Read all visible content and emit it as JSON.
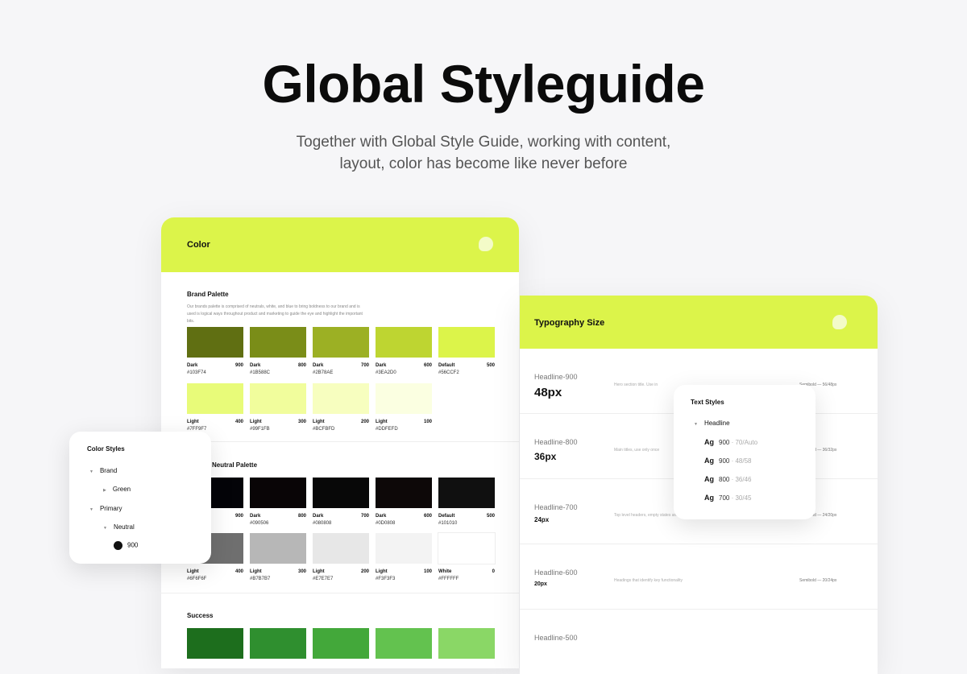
{
  "hero": {
    "title": "Global Styleguide",
    "subtitle_line1": "Together with Global Style Guide, working with content,",
    "subtitle_line2": "layout, color has become like never before"
  },
  "color_card": {
    "title": "Color",
    "brand": {
      "title": "Brand Palette",
      "description": "Our brands palette is comprised of neutrals, white, and blue to bring boldness to our brand and is used is logical ways throughout product and marketing to guide the eye and highlight the important bits.",
      "swatches": [
        {
          "name": "Dark",
          "num": "900",
          "hex": "#103F74",
          "color": "#606f12"
        },
        {
          "name": "Dark",
          "num": "800",
          "hex": "#1B588C",
          "color": "#7a8d18"
        },
        {
          "name": "Dark",
          "num": "700",
          "hex": "#2B78AE",
          "color": "#9cb024"
        },
        {
          "name": "Dark",
          "num": "600",
          "hex": "#3EA2D0",
          "color": "#bed531"
        },
        {
          "name": "Default",
          "num": "500",
          "hex": "#56CCF2",
          "color": "#dcf44a"
        },
        {
          "name": "Light",
          "num": "400",
          "hex": "#7FF9F7",
          "color": "#e8fb79"
        },
        {
          "name": "Light",
          "num": "300",
          "hex": "#99F1FB",
          "color": "#f1fd9c"
        },
        {
          "name": "Light",
          "num": "200",
          "hex": "#BCFBFD",
          "color": "#f7febf"
        },
        {
          "name": "Light",
          "num": "100",
          "hex": "#DDFEFD",
          "color": "#fbffe1"
        }
      ]
    },
    "neutral": {
      "title": "Neutral Palette",
      "swatches": [
        {
          "name": "Dark",
          "num": "900",
          "hex": "",
          "color": "#040408"
        },
        {
          "name": "Dark",
          "num": "800",
          "hex": "#090506",
          "color": "#090506"
        },
        {
          "name": "Dark",
          "num": "700",
          "hex": "#080808",
          "color": "#080808"
        },
        {
          "name": "Dark",
          "num": "600",
          "hex": "#0D0808",
          "color": "#0d0808"
        },
        {
          "name": "Default",
          "num": "500",
          "hex": "#101010",
          "color": "#101010"
        },
        {
          "name": "Light",
          "num": "400",
          "hex": "#6F6F6F",
          "color": "#6f6f6f"
        },
        {
          "name": "Light",
          "num": "300",
          "hex": "#B7B7B7",
          "color": "#b7b7b7"
        },
        {
          "name": "Light",
          "num": "200",
          "hex": "#E7E7E7",
          "color": "#e7e7e7"
        },
        {
          "name": "Light",
          "num": "100",
          "hex": "#F3F3F3",
          "color": "#f3f3f3"
        },
        {
          "name": "White",
          "num": "0",
          "hex": "#FFFFFF",
          "color": "#ffffff"
        }
      ]
    },
    "success": {
      "title": "Success",
      "swatches": [
        {
          "color": "#1d6e1d"
        },
        {
          "color": "#2f8f2f"
        },
        {
          "color": "#43a83a"
        },
        {
          "color": "#63c24f"
        },
        {
          "color": "#8ad766"
        }
      ]
    }
  },
  "type_card": {
    "title": "Typography Size",
    "rows": [
      {
        "name": "Headline-900",
        "size": "48px",
        "desc": "Hero section title. Use in",
        "spec": "Semibold — 56/48px"
      },
      {
        "name": "Headline-800",
        "size": "36px",
        "desc": "Main titles, use only once",
        "spec": "Semibold — 36/32px"
      },
      {
        "name": "Headline-700",
        "size": "24px",
        "desc": "Top level headers, empty states and action statements",
        "spec": "Semibold — 24/20px"
      },
      {
        "name": "Headline-600",
        "size": "20px",
        "desc": "Headings that identify key functionality",
        "spec": "Semibold — 20/24px"
      },
      {
        "name": "Headline-500",
        "size": "",
        "desc": "",
        "spec": ""
      }
    ]
  },
  "text_styles": {
    "title": "Text Styles",
    "group": "Headline",
    "items": [
      {
        "ag": "Ag",
        "weight": "900",
        "metric": "· 70/Auto"
      },
      {
        "ag": "Ag",
        "weight": "900",
        "metric": "· 48/58"
      },
      {
        "ag": "Ag",
        "weight": "800",
        "metric": "· 36/46"
      },
      {
        "ag": "Ag",
        "weight": "700",
        "metric": "· 30/45"
      }
    ]
  },
  "color_styles": {
    "title": "Color Styles",
    "tree": [
      "Brand",
      "Green",
      "Primary",
      "Neutral",
      "900"
    ]
  },
  "colors": {
    "accent": "#dcf44a",
    "background": "#f6f6f8"
  },
  "icons": {
    "brand_logo": "leaf-logo-icon",
    "expanded": "triangle-down-icon",
    "collapsed": "triangle-right-icon"
  }
}
